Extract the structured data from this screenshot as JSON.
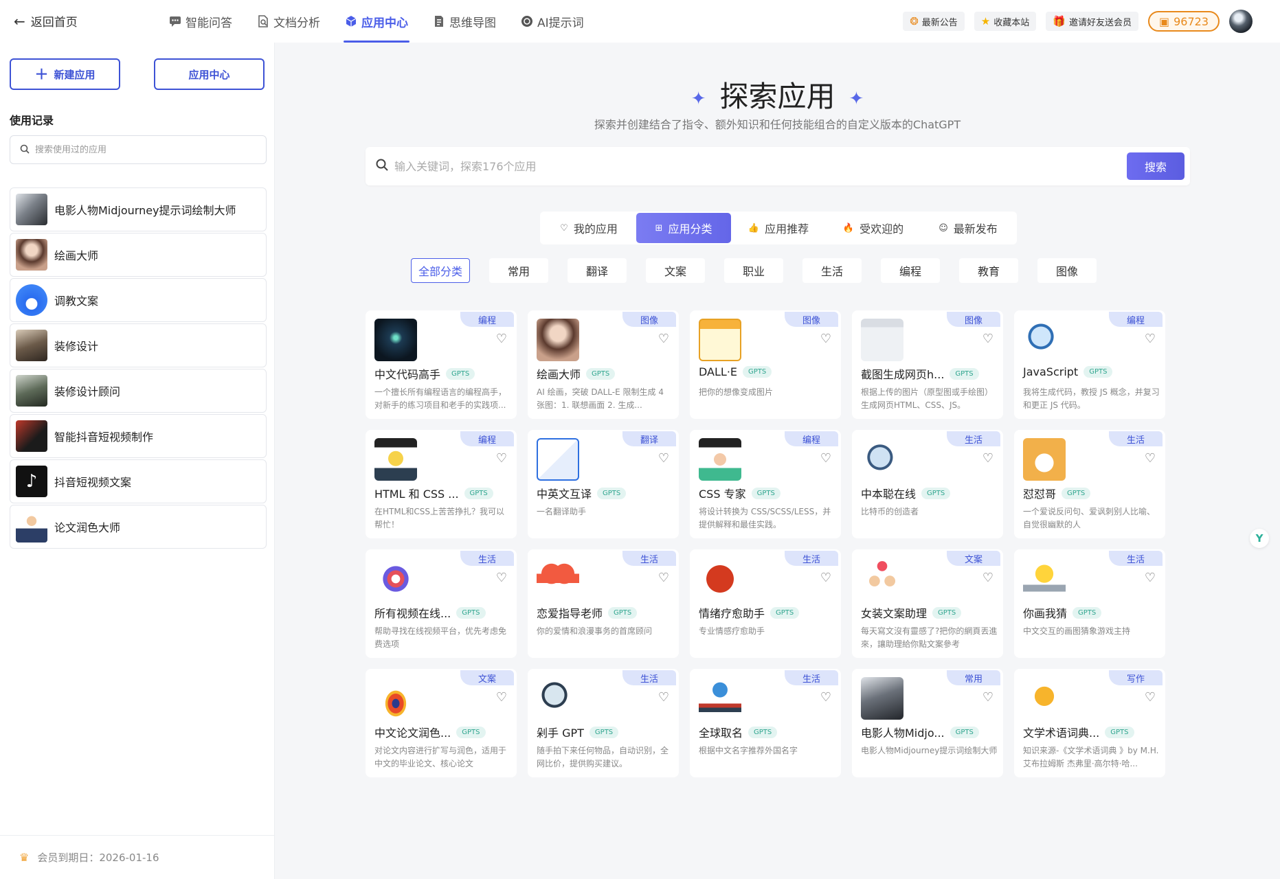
{
  "topbar": {
    "back_label": "返回首页",
    "nav": [
      {
        "label": "智能问答",
        "icon": "chat-icon"
      },
      {
        "label": "文档分析",
        "icon": "document-search-icon"
      },
      {
        "label": "应用中心",
        "icon": "cube-icon",
        "active": true
      },
      {
        "label": "思维导图",
        "icon": "mindmap-icon"
      },
      {
        "label": "AI提示词",
        "icon": "openai-icon"
      }
    ],
    "right": {
      "announce": "最新公告",
      "bookmark": "收藏本站",
      "invite": "邀请好友送会员",
      "coins": "96723"
    }
  },
  "sidebar": {
    "new_app": "新建应用",
    "app_center": "应用中心",
    "history_title": "使用记录",
    "search_placeholder": "搜索使用过的应用",
    "history": [
      {
        "label": "电影人物Midjourney提示词绘制大师"
      },
      {
        "label": "绘画大师"
      },
      {
        "label": "调教文案"
      },
      {
        "label": "装修设计"
      },
      {
        "label": "装修设计顾问"
      },
      {
        "label": "智能抖音短视频制作"
      },
      {
        "label": "抖音短视频文案"
      },
      {
        "label": "论文润色大师"
      }
    ],
    "expire": "会员到期日：2026-01-16"
  },
  "main": {
    "title": "探索应用",
    "subtitle": "探索并创建结合了指令、额外知识和任何技能组合的自定义版本的ChatGPT",
    "search_placeholder": "输入关键词，探索176个应用",
    "search_button": "搜索",
    "tabs": [
      {
        "label": "我的应用",
        "icon": "♡"
      },
      {
        "label": "应用分类",
        "icon": "⊞",
        "active": true
      },
      {
        "label": "应用推荐",
        "icon": "👍"
      },
      {
        "label": "受欢迎的",
        "icon": "🔥"
      },
      {
        "label": "最新发布",
        "icon": "☺"
      }
    ],
    "categories": [
      "全部分类",
      "常用",
      "翻译",
      "文案",
      "职业",
      "生活",
      "编程",
      "教育",
      "图像"
    ],
    "gpts_label": "GPTS",
    "cards": [
      {
        "name": "中文代码高手",
        "tag": "编程",
        "desc": "一个擅长所有编程语言的编程高手，对新手的练习项目和老手的实践项..."
      },
      {
        "name": "绘画大师",
        "tag": "图像",
        "desc": "AI 绘画，突破 DALL-E 限制生成 4 张图：1. 联想画面 2. 生成..."
      },
      {
        "name": "DALL·E",
        "tag": "图像",
        "desc": "把你的想像变成图片"
      },
      {
        "name": "截图生成网页h...",
        "tag": "图像",
        "desc": "根据上传的图片（原型图或手绘图）生成网页HTML、CSS、JS。"
      },
      {
        "name": "JavaScript",
        "tag": "编程",
        "desc": "我将生成代码，教授 JS 概念，并复习和更正 JS 代码。"
      },
      {
        "name": "HTML 和 CSS ...",
        "tag": "编程",
        "desc": "在HTML和CSS上苦苦挣扎？我可以帮忙！"
      },
      {
        "name": "中英文互译",
        "tag": "翻译",
        "desc": "一名翻译助手"
      },
      {
        "name": "CSS 专家",
        "tag": "编程",
        "desc": "将设计转换为 CSS/SCSS/LESS，并提供解释和最佳实践。"
      },
      {
        "name": "中本聪在线",
        "tag": "生活",
        "desc": "比特币的创造者"
      },
      {
        "name": "怼怼哥",
        "tag": "生活",
        "desc": "一个爱说反问句、爱讽刺别人比喻、自觉很幽默的人"
      },
      {
        "name": "所有视频在线...",
        "tag": "生活",
        "desc": "帮助寻找在线视频平台，优先考虑免费选项"
      },
      {
        "name": "恋爱指导老师",
        "tag": "生活",
        "desc": "你的爱情和浪漫事务的首席顾问"
      },
      {
        "name": "情绪疗愈助手",
        "tag": "生活",
        "desc": "专业情感疗愈助手"
      },
      {
        "name": "女装文案助理",
        "tag": "文案",
        "desc": "每天寫文沒有靈感了?把你的網頁丟進來，讓助理給你點文案參考"
      },
      {
        "name": "你画我猜",
        "tag": "生活",
        "desc": "中文交互的画图猜象游戏主持"
      },
      {
        "name": "中文论文润色...",
        "tag": "文案",
        "desc": "对论文内容进行扩写与润色，适用于中文的毕业论文、核心论文"
      },
      {
        "name": "剁手 GPT",
        "tag": "生活",
        "desc": "随手拍下来任何物品，自动识别，全网比价，提供购买建议。"
      },
      {
        "name": "全球取名",
        "tag": "生活",
        "desc": "根据中文名字推荐外国名字"
      },
      {
        "name": "电影人物Midjo...",
        "tag": "常用",
        "desc": "电影人物Midjourney提示词绘制大师"
      },
      {
        "name": "文学术语词典...",
        "tag": "写作",
        "desc": "知识来源-《文学术语词典 》by M.H.艾布拉姆斯 杰弗里·高尔特·哈..."
      }
    ]
  },
  "colors": {
    "accent": "#4a5de8",
    "coins": "#e8891b",
    "gpts_bg": "#e3f4f1",
    "tag_bg": "#dde4fb"
  }
}
